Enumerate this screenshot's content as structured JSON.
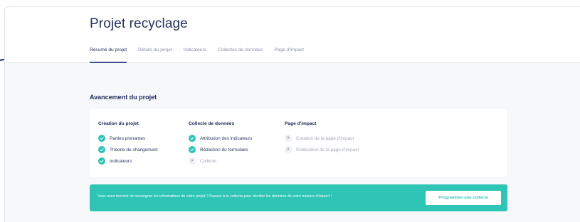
{
  "project": {
    "title": "Projet recyclage"
  },
  "tabs": [
    {
      "label": "Résumé du projet",
      "active": true
    },
    {
      "label": "Détails du projet",
      "active": false
    },
    {
      "label": "Indicateurs",
      "active": false
    },
    {
      "label": "Collectes de données",
      "active": false
    },
    {
      "label": "Page d'impact",
      "active": false
    }
  ],
  "progress": {
    "title": "Avancement du projet",
    "columns": [
      {
        "title": "Création du projet",
        "items": [
          {
            "label": "Parties prenantes",
            "done": true
          },
          {
            "label": "Théorie du changement",
            "done": true
          },
          {
            "label": "Indicateurs",
            "done": true
          }
        ]
      },
      {
        "title": "Collecte de données",
        "items": [
          {
            "label": "Attribution des indicateurs",
            "done": true
          },
          {
            "label": "Rédaction du formulaire",
            "done": true
          },
          {
            "label": "Collecte",
            "done": false
          }
        ]
      },
      {
        "title": "Page d'impact",
        "items": [
          {
            "label": "Création de la page d'impact",
            "done": false
          },
          {
            "label": "Publication de la page d'impact",
            "done": false
          }
        ]
      }
    ]
  },
  "banner": {
    "text": "Vous avez terminé de renseigner les informations de votre projet ? Passez à la collecte pour récolter les données de votre mesure d'impact !",
    "button_label": "Programmer une collecte"
  },
  "icons": {
    "done": "check-circle-icon",
    "pending": "cross-circle-icon"
  },
  "colors": {
    "accent": "#2ec4b6",
    "primary_text": "#1e2a5a",
    "active_tab_underline": "#3d4a8c",
    "background": "#f7f8fa"
  }
}
